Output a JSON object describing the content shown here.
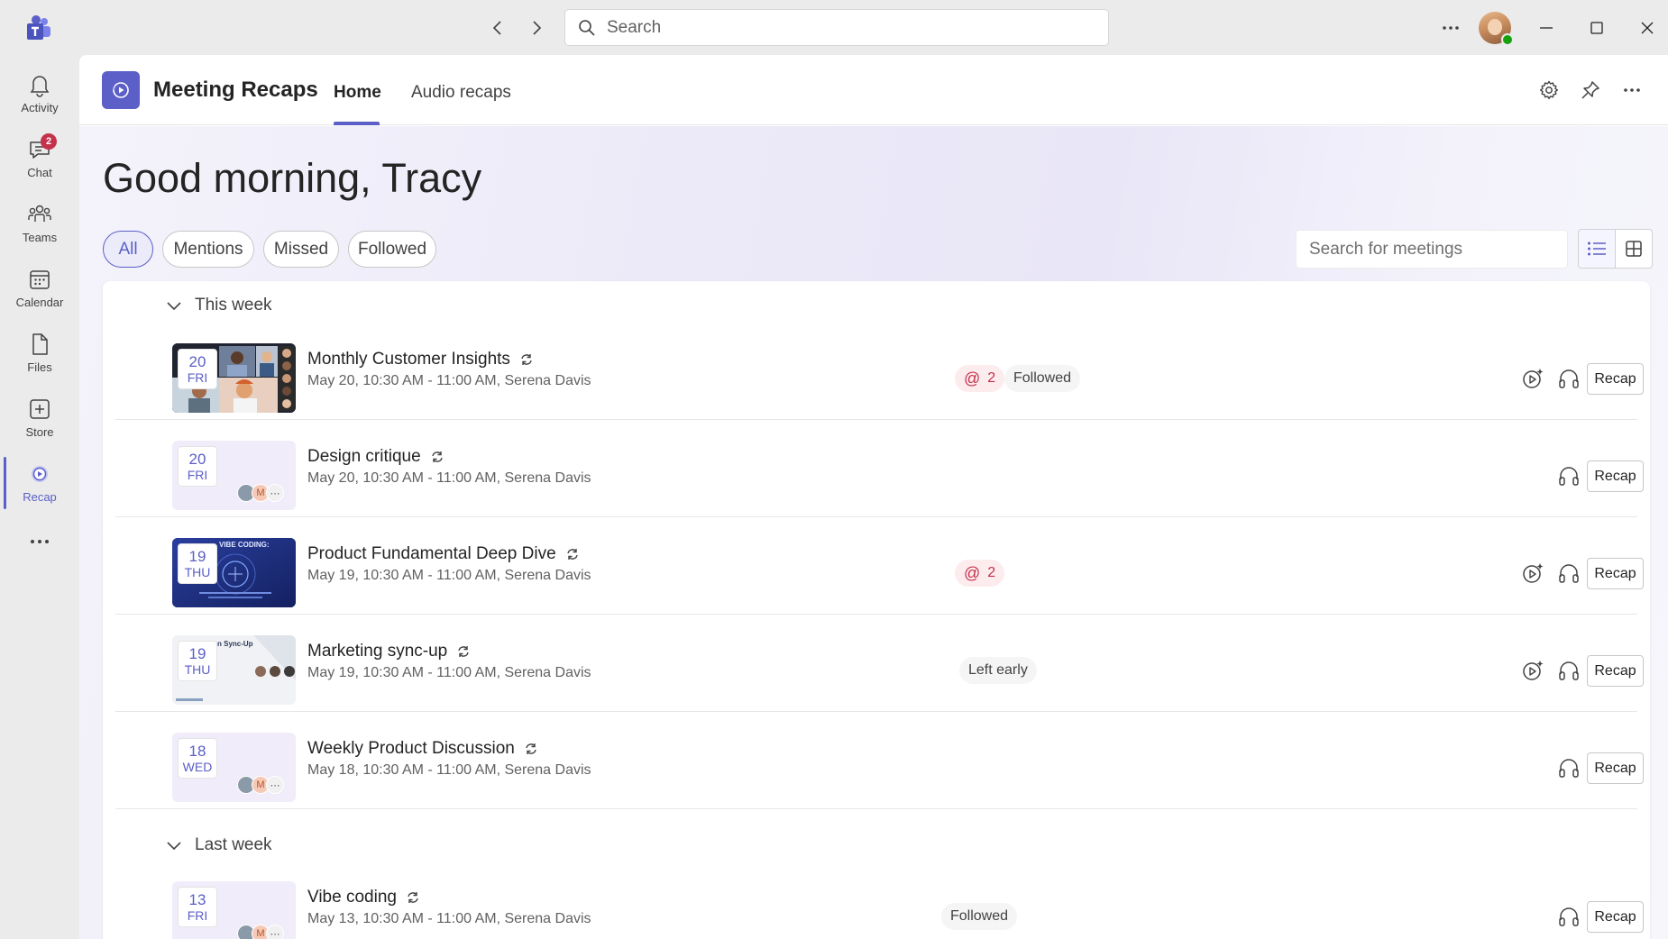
{
  "titlebar": {
    "search_placeholder": "Search"
  },
  "rail": {
    "items": [
      {
        "label": "Activity",
        "icon": "bell-icon"
      },
      {
        "label": "Chat",
        "icon": "chat-icon",
        "badge": "2"
      },
      {
        "label": "Teams",
        "icon": "teams-icon"
      },
      {
        "label": "Calendar",
        "icon": "calendar-icon"
      },
      {
        "label": "Files",
        "icon": "file-icon"
      },
      {
        "label": "Store",
        "icon": "store-icon"
      },
      {
        "label": "Recap",
        "icon": "recap-icon",
        "active": true
      }
    ]
  },
  "app": {
    "title": "Meeting Recaps",
    "tabs": [
      {
        "label": "Home",
        "active": true
      },
      {
        "label": "Audio recaps",
        "active": false
      }
    ]
  },
  "greeting": "Good morning, Tracy",
  "filters": [
    "All",
    "Mentions",
    "Missed",
    "Followed"
  ],
  "meeting_search_placeholder": "Search for meetings",
  "sections": [
    {
      "label": "This week",
      "meetings": [
        {
          "day_num": "20",
          "day_name": "FRI",
          "title": "Monthly Customer Insights",
          "subtitle": "May 20, 10:30 AM - 11:00 AM, Serena Davis",
          "mentions": "2",
          "status": "Followed",
          "recap_label": "Recap"
        },
        {
          "day_num": "20",
          "day_name": "FRI",
          "title": "Design critique",
          "subtitle": "May 20, 10:30 AM - 11:00 AM, Serena Davis",
          "avatar_initial": "M",
          "recap_label": "Recap"
        },
        {
          "day_num": "19",
          "day_name": "THU",
          "title": "Product Fundamental Deep Dive",
          "subtitle": "May 19, 10:30 AM - 11:00 AM, Serena Davis",
          "mentions": "2",
          "recap_label": "Recap"
        },
        {
          "day_num": "19",
          "day_name": "THU",
          "title": "Marketing sync-up",
          "subtitle": "May 19, 10:30 AM - 11:00 AM, Serena Davis",
          "status": "Left early",
          "recap_label": "Recap"
        },
        {
          "day_num": "18",
          "day_name": "WED",
          "title": "Weekly Product Discussion",
          "subtitle": "May 18, 10:30 AM - 11:00 AM, Serena Davis",
          "avatar_initial": "M",
          "recap_label": "Recap"
        }
      ]
    },
    {
      "label": "Last week",
      "meetings": [
        {
          "day_num": "13",
          "day_name": "FRI",
          "title": "Vibe coding",
          "subtitle": "May 13, 10:30 AM - 11:00 AM, Serena Davis",
          "avatar_initial": "M",
          "status": "Followed",
          "recap_label": "Recap"
        }
      ]
    }
  ],
  "thumb_text": {
    "vibe_banner": "VIBE CODING:",
    "sync_banner": "n Sync-Up"
  },
  "colors": {
    "accent": "#5b5fc7",
    "mention": "#c4314b",
    "presence": "#13a10e"
  }
}
